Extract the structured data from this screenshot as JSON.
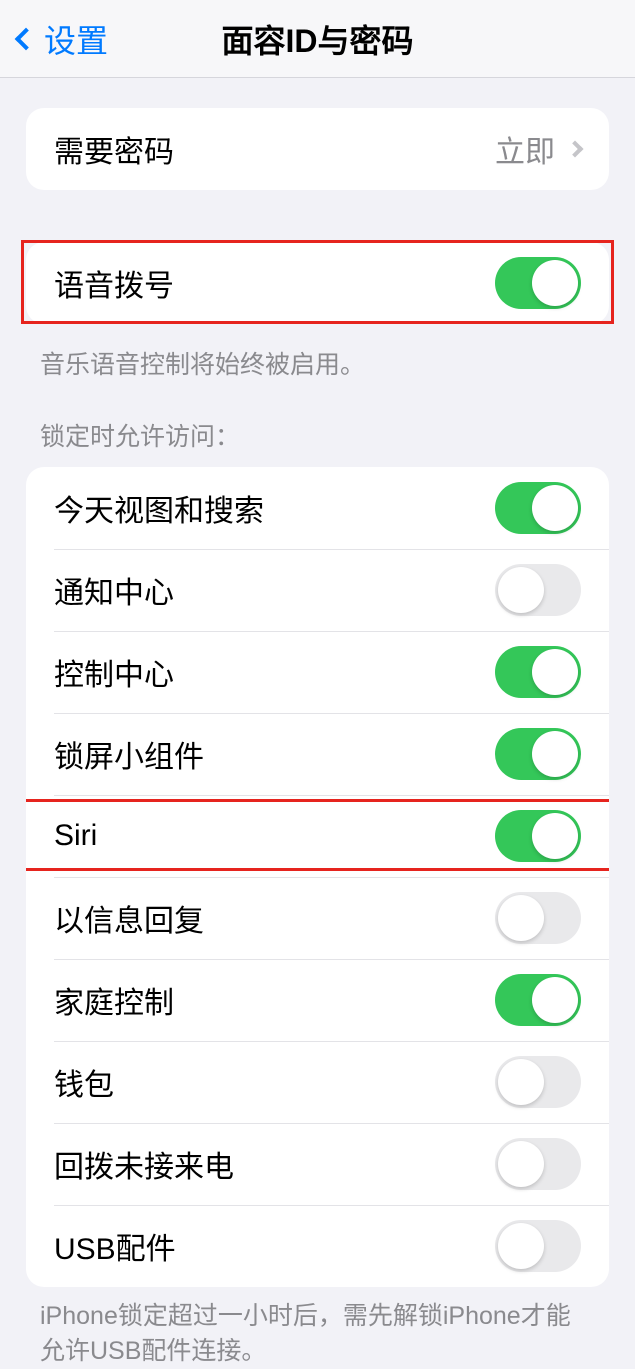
{
  "header": {
    "back_label": "设置",
    "title": "面容ID与密码"
  },
  "group1": {
    "require_password": {
      "label": "需要密码",
      "value": "立即"
    }
  },
  "group2": {
    "voice_dial": {
      "label": "语音拨号",
      "on": true
    },
    "footer": "音乐语音控制将始终被启用。"
  },
  "section_header": "锁定时允许访问：",
  "group3": {
    "items": [
      {
        "label": "今天视图和搜索",
        "on": true
      },
      {
        "label": "通知中心",
        "on": false
      },
      {
        "label": "控制中心",
        "on": true
      },
      {
        "label": "锁屏小组件",
        "on": true
      },
      {
        "label": "Siri",
        "on": true
      },
      {
        "label": "以信息回复",
        "on": false
      },
      {
        "label": "家庭控制",
        "on": true
      },
      {
        "label": "钱包",
        "on": false
      },
      {
        "label": "回拨未接来电",
        "on": false
      },
      {
        "label": "USB配件",
        "on": false
      }
    ],
    "footer": "iPhone锁定超过一小时后，需先解锁iPhone才能允许USB配件连接。"
  }
}
